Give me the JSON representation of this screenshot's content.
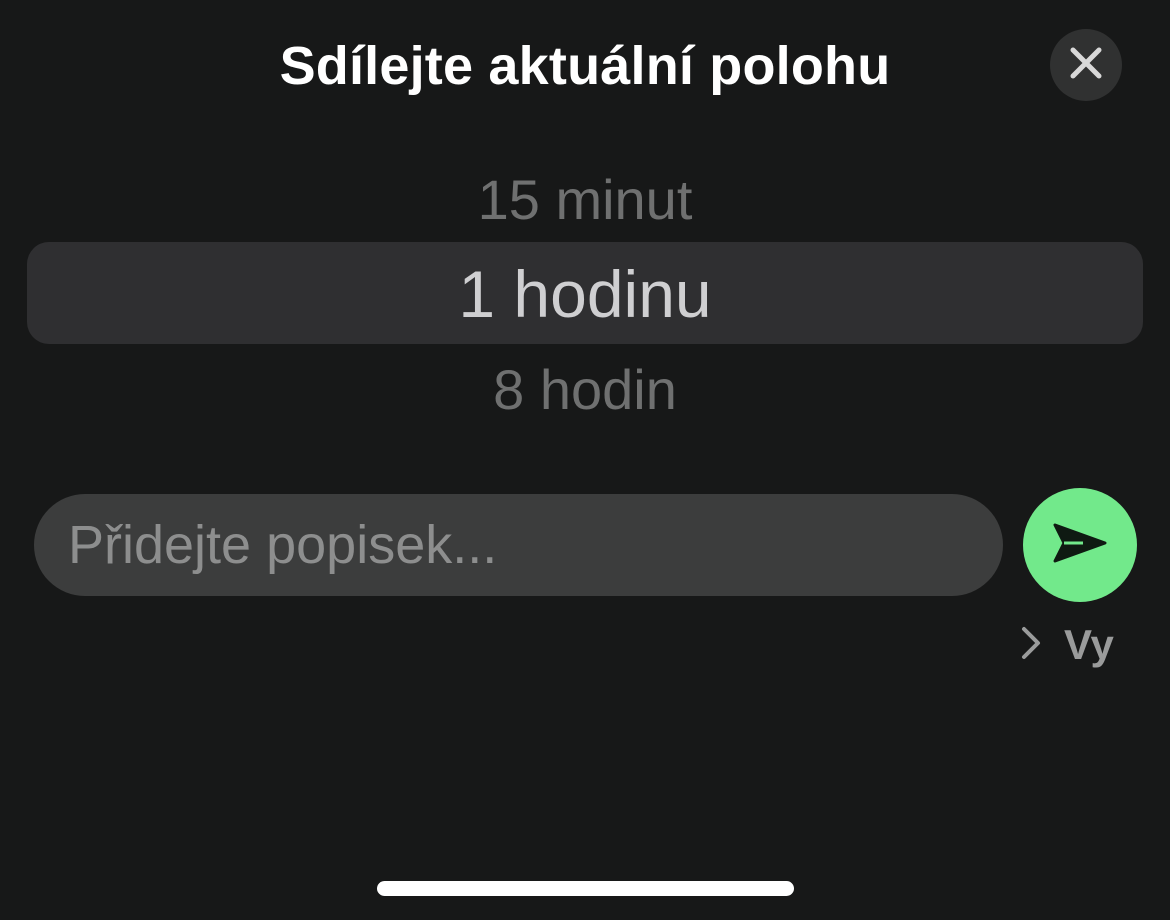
{
  "header": {
    "title": "Sdílejte aktuální polohu",
    "close_icon": "close-icon"
  },
  "duration_picker": {
    "options": [
      "15 minut",
      "1 hodinu",
      "8 hodin"
    ],
    "selected": "1 hodinu"
  },
  "caption": {
    "value": "",
    "placeholder": "Přidejte popisek..."
  },
  "send": {
    "icon": "send-icon",
    "color": "#72e98b"
  },
  "recipient": {
    "icon": "chevron-right-icon",
    "label": "Vy"
  },
  "colors": {
    "background": "#171818",
    "accent": "#72e98b"
  }
}
